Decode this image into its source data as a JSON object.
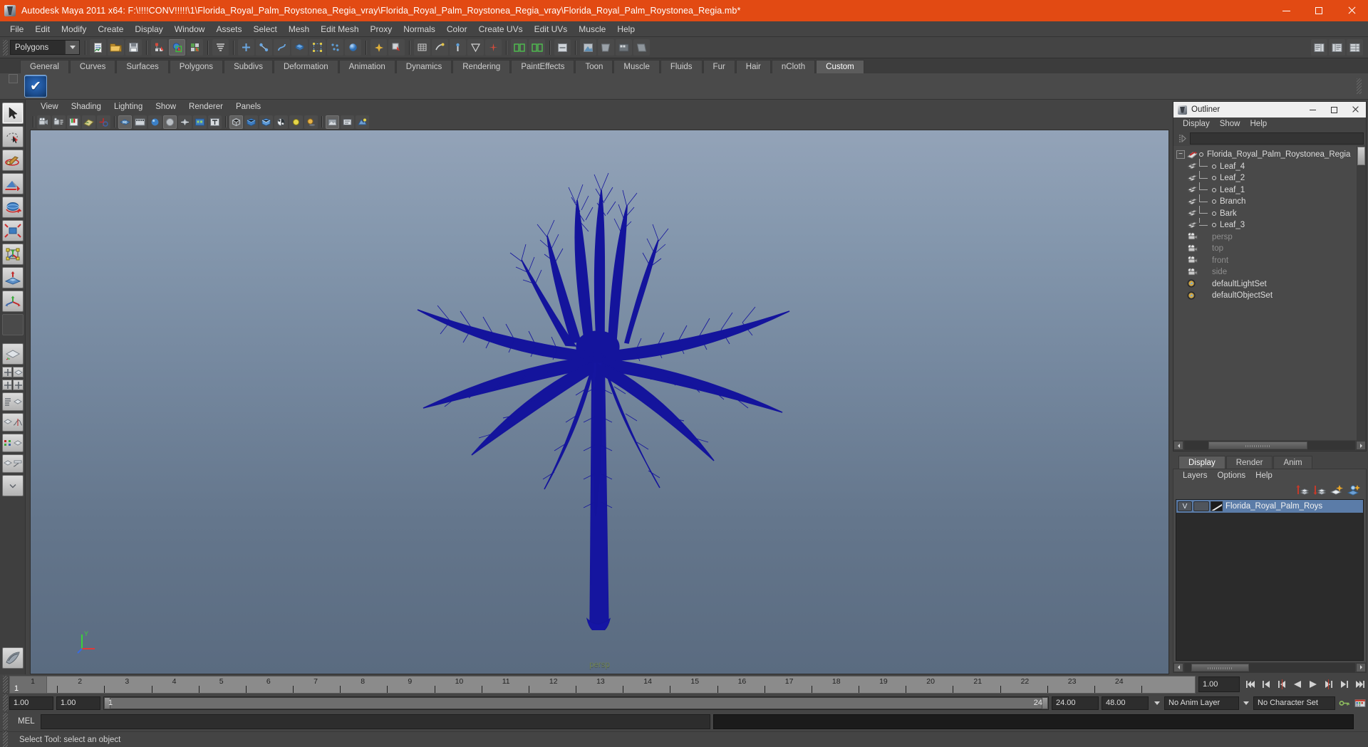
{
  "titlebar": {
    "title": "Autodesk Maya 2011 x64: F:\\!!!!CONV!!!!!\\1\\Florida_Royal_Palm_Roystonea_Regia_vray\\Florida_Royal_Palm_Roystonea_Regia_vray\\Florida_Royal_Palm_Roystonea_Regia.mb*",
    "app_icon": "maya-icon",
    "minimize": "minimize-icon",
    "maximize": "maximize-icon",
    "close": "close-icon",
    "accent_color": "#e24a13"
  },
  "menubar": {
    "items": [
      "File",
      "Edit",
      "Modify",
      "Create",
      "Display",
      "Window",
      "Assets",
      "Select",
      "Mesh",
      "Edit Mesh",
      "Proxy",
      "Normals",
      "Color",
      "Create UVs",
      "Edit UVs",
      "Muscle",
      "Help"
    ]
  },
  "statusline": {
    "mode_selector": "Polygons",
    "dropdown_icon": "chevron-down-icon"
  },
  "shelf": {
    "tabs": [
      "General",
      "Curves",
      "Surfaces",
      "Polygons",
      "Subdivs",
      "Deformation",
      "Animation",
      "Dynamics",
      "Rendering",
      "PaintEffects",
      "Toon",
      "Muscle",
      "Fluids",
      "Fur",
      "Hair",
      "nCloth",
      "Custom"
    ],
    "active_tab": "Custom",
    "icon_name": "blue-check-shelf-icon"
  },
  "viewport": {
    "panel_menu": [
      "View",
      "Shading",
      "Lighting",
      "Show",
      "Renderer",
      "Panels"
    ],
    "camera_label": "persp",
    "model_color": "#1414a0",
    "bg_top": "#93a3b8",
    "bg_bottom": "#5a6b80",
    "axis": {
      "y": "Y",
      "x": "X",
      "z": "Z"
    }
  },
  "outliner": {
    "window_title": "Outliner",
    "menu": [
      "Display",
      "Show",
      "Help"
    ],
    "search_value": "",
    "items": [
      {
        "label": "Florida_Royal_Palm_Roystonea_Regia",
        "icon": "transform-icon",
        "level": 0,
        "expanded": true,
        "dim": false
      },
      {
        "label": "Leaf_4",
        "icon": "mesh-icon",
        "level": 1,
        "dim": false
      },
      {
        "label": "Leaf_2",
        "icon": "mesh-icon",
        "level": 1,
        "dim": false
      },
      {
        "label": "Leaf_1",
        "icon": "mesh-icon",
        "level": 1,
        "dim": false
      },
      {
        "label": "Branch",
        "icon": "mesh-icon",
        "level": 1,
        "dim": false
      },
      {
        "label": "Bark",
        "icon": "mesh-icon",
        "level": 1,
        "dim": false
      },
      {
        "label": "Leaf_3",
        "icon": "mesh-icon",
        "level": 1,
        "last": true,
        "dim": false
      },
      {
        "label": "persp",
        "icon": "camera-icon",
        "level": 0,
        "dim": true
      },
      {
        "label": "top",
        "icon": "camera-icon",
        "level": 0,
        "dim": true
      },
      {
        "label": "front",
        "icon": "camera-icon",
        "level": 0,
        "dim": true
      },
      {
        "label": "side",
        "icon": "camera-icon",
        "level": 0,
        "dim": true
      },
      {
        "label": "defaultLightSet",
        "icon": "set-icon",
        "level": 0,
        "dim": false
      },
      {
        "label": "defaultObjectSet",
        "icon": "set-icon",
        "level": 0,
        "dim": false
      }
    ]
  },
  "layer_editor": {
    "tabs": [
      "Display",
      "Render",
      "Anim"
    ],
    "active_tab": "Display",
    "menu": [
      "Layers",
      "Options",
      "Help"
    ],
    "tool_icons": [
      "layer-up-icon",
      "layer-down-icon",
      "new-layer-icon",
      "new-layer-from-selected-icon"
    ],
    "layers": [
      {
        "visibility": "V",
        "playback": "",
        "name": "Florida_Royal_Palm_Roys",
        "selected": true
      }
    ]
  },
  "time_slider": {
    "ticks": [
      1,
      2,
      3,
      4,
      5,
      6,
      7,
      8,
      9,
      10,
      11,
      12,
      13,
      14,
      15,
      16,
      17,
      18,
      19,
      20,
      21,
      22,
      23,
      24
    ],
    "current_frame": "1",
    "current_frame_field": "1.00",
    "playback_buttons": [
      "go-to-start-icon",
      "step-back-keyframe-icon",
      "step-back-frame-icon",
      "play-backwards-icon",
      "play-forwards-icon",
      "step-forward-frame-icon",
      "step-forward-keyframe-icon",
      "go-to-end-icon"
    ]
  },
  "range_slider": {
    "anim_start": "1.00",
    "range_start": "1.00",
    "bar_start": "1",
    "bar_end": "24",
    "range_end": "24.00",
    "anim_end": "48.00",
    "anim_layer": "No Anim Layer",
    "character_set": "No Character Set",
    "key_icon": "key-icon",
    "auto_key_icon": "auto-keyframe-icon",
    "anim_prefs_icon": "animation-preferences-icon"
  },
  "command_line": {
    "label": "MEL",
    "value": "",
    "output": ""
  },
  "help_line": {
    "text": "Select Tool: select an object"
  },
  "toolbox": {
    "tools": [
      "select-tool",
      "lasso-select-tool",
      "paint-select-tool",
      "move-tool",
      "rotate-tool",
      "scale-tool",
      "universal-manipulator-tool",
      "soft-modification-tool",
      "last-tool-used",
      "blank-tool"
    ]
  }
}
